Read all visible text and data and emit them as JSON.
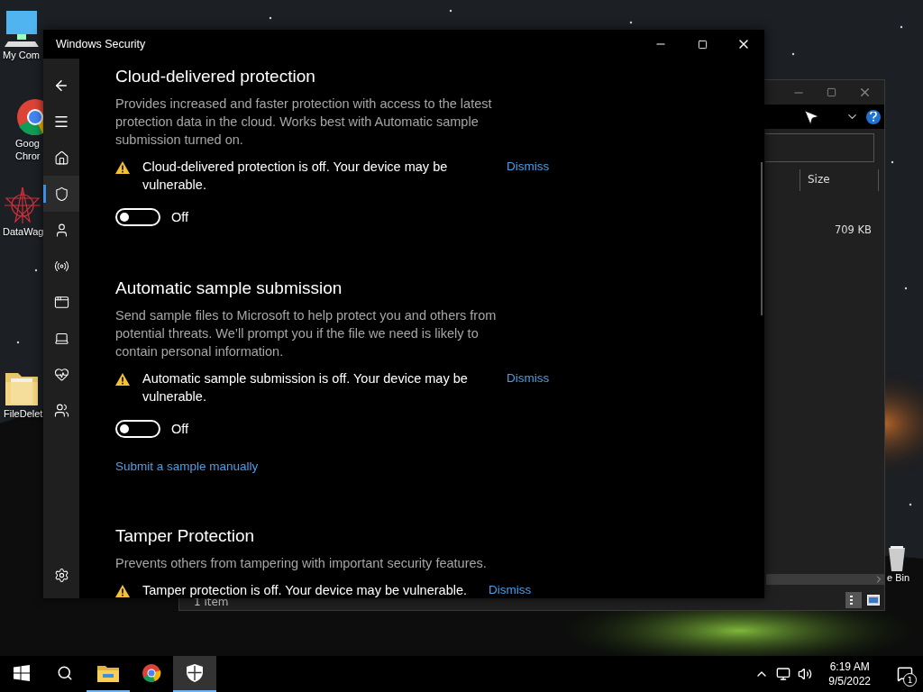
{
  "desktop_icons": [
    {
      "kind": "computer",
      "lines": [
        "My Com"
      ]
    },
    {
      "kind": "chrome",
      "lines": [
        "Goog",
        "Chror"
      ]
    },
    {
      "kind": "burst",
      "lines": [
        "DataWag"
      ]
    },
    {
      "kind": "folder",
      "lines": [
        "FileDelet"
      ]
    },
    {
      "kind": "recycle",
      "lines": [
        "e Bin"
      ]
    }
  ],
  "explorer": {
    "columns": [
      "Size"
    ],
    "rows": [
      {
        "size": "709 KB"
      }
    ],
    "status_bar": "1 item"
  },
  "security": {
    "title": "Windows Security",
    "sidebar": [
      {
        "kind": "home",
        "selected": false
      },
      {
        "kind": "shield",
        "selected": true
      },
      {
        "kind": "account",
        "selected": false
      },
      {
        "kind": "network",
        "selected": false
      },
      {
        "kind": "browser",
        "selected": false
      },
      {
        "kind": "device",
        "selected": false
      },
      {
        "kind": "health",
        "selected": false
      },
      {
        "kind": "family",
        "selected": false
      }
    ],
    "sections": [
      {
        "title": "Cloud-delivered protection",
        "description": "Provides increased and faster protection with access to the latest protection data in the cloud. Works best with Automatic sample submission turned on.",
        "warning": {
          "text": "Cloud-delivered protection is off. Your device may be vulnerable.",
          "action": "Dismiss"
        },
        "toggle": {
          "on": false,
          "label": "Off"
        }
      },
      {
        "title": "Automatic sample submission",
        "description": "Send sample files to Microsoft to help protect you and others from potential threats. We’ll prompt you if the file we need is likely to contain personal information.",
        "warning": {
          "text": "Automatic sample submission is off. Your device may be vulnerable.",
          "action": "Dismiss"
        },
        "toggle": {
          "on": false,
          "label": "Off"
        },
        "link": "Submit a sample manually"
      },
      {
        "title": "Tamper Protection",
        "description": "Prevents others from tampering with important security features.",
        "warning": {
          "text": "Tamper protection is off. Your device may be vulnerable.",
          "action": "Dismiss"
        }
      }
    ]
  },
  "taskbar": {
    "apps": [
      {
        "kind": "explorer",
        "running": true,
        "selected": false
      },
      {
        "kind": "chrome",
        "running": false,
        "selected": false
      },
      {
        "kind": "security",
        "running": true,
        "selected": true
      }
    ],
    "time": "6:19 AM",
    "date": "9/5/2022",
    "notifications": "1"
  }
}
